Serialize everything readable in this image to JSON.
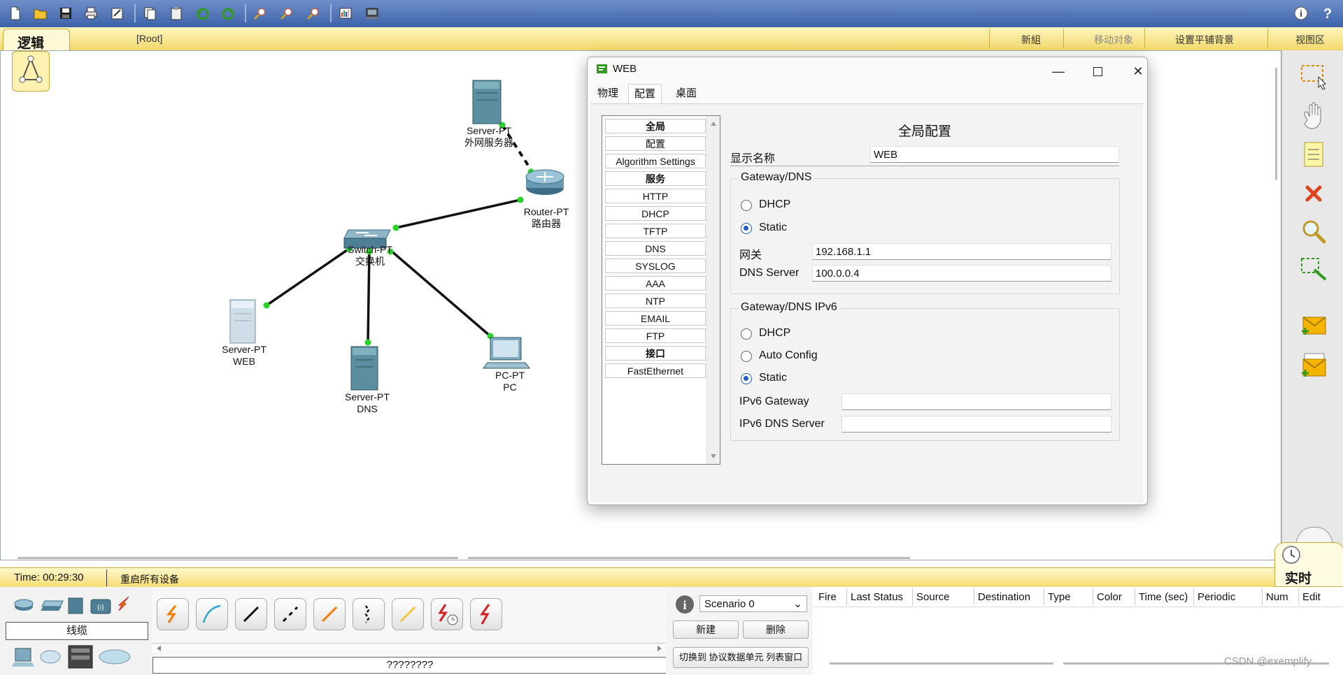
{
  "toolbar": {
    "icons": [
      "new-file-icon",
      "open-folder-icon",
      "save-icon",
      "print-icon",
      "activity-wizard-icon",
      "copy-icon",
      "paste-icon",
      "undo-icon",
      "redo-icon",
      "zoom-in-icon",
      "zoom-reset-icon",
      "zoom-out-icon",
      "palette-icon",
      "custom-device-icon",
      "info-icon",
      "help-icon"
    ]
  },
  "navbar": {
    "logic_tab": "逻辑",
    "root": "[Root]",
    "new_cluster": "新組",
    "move_object": "移动对象",
    "set_background": "设置平铺背景",
    "viewport": "视图区"
  },
  "devices": [
    {
      "name": "Server-PT",
      "label": "外网服务器"
    },
    {
      "name": "Router-PT",
      "label": "路由器"
    },
    {
      "name": "Switch-PT",
      "label": "交换机"
    },
    {
      "name": "Server-PT",
      "label": "WEB"
    },
    {
      "name": "Server-PT",
      "label": "DNS"
    },
    {
      "name": "PC-PT",
      "label": "PC"
    }
  ],
  "dialog": {
    "title": "WEB",
    "tabs": [
      "物理",
      "配置",
      "桌面"
    ],
    "active_tab": "配置",
    "menu": [
      {
        "label": "全局",
        "head": true
      },
      {
        "label": "配置",
        "head": false
      },
      {
        "label": "Algorithm Settings",
        "head": false
      },
      {
        "label": "服务",
        "head": true
      },
      {
        "label": "HTTP",
        "head": false
      },
      {
        "label": "DHCP",
        "head": false
      },
      {
        "label": "TFTP",
        "head": false
      },
      {
        "label": "DNS",
        "head": false
      },
      {
        "label": "SYSLOG",
        "head": false
      },
      {
        "label": "AAA",
        "head": false
      },
      {
        "label": "NTP",
        "head": false
      },
      {
        "label": "EMAIL",
        "head": false
      },
      {
        "label": "FTP",
        "head": false
      },
      {
        "label": "接口",
        "head": true
      },
      {
        "label": "FastEthernet",
        "head": false
      }
    ],
    "section_title": "全局配置",
    "display_name_label": "显示名称",
    "display_name_value": "WEB",
    "gateway_group": {
      "title": "Gateway/DNS",
      "dhcp": "DHCP",
      "static": "Static",
      "selected": "Static",
      "gateway_label": "网关",
      "gateway_value": "192.168.1.1",
      "dns_label": "DNS Server",
      "dns_value": "100.0.0.4"
    },
    "ipv6_group": {
      "title": "Gateway/DNS IPv6",
      "dhcp": "DHCP",
      "auto": "Auto Config",
      "static": "Static",
      "selected": "Static",
      "gateway_label": "IPv6 Gateway",
      "gateway_value": "",
      "dns_label": "IPv6 DNS Server",
      "dns_value": ""
    }
  },
  "status": {
    "time": "Time: 00:29:30",
    "power_cycle": "重启所有设备",
    "realtime": "实时"
  },
  "bottom": {
    "category_label": "线缆",
    "cable_caption": "????????",
    "scenario": "Scenario 0",
    "new_btn": "新建",
    "delete_btn": "删除",
    "toggle_pdu": "切换到 协议数据单元 列表窗口",
    "columns": [
      "Fire",
      "Last Status",
      "Source",
      "Destination",
      "Type",
      "Color",
      "Time (sec)",
      "Periodic",
      "Num",
      "Edit"
    ]
  },
  "watermark": "CSDN @exemplify",
  "colors": {
    "link": "#111111",
    "port": "#28d428",
    "accent": "#1c5fc8",
    "toolbar": "#4a6db2"
  }
}
